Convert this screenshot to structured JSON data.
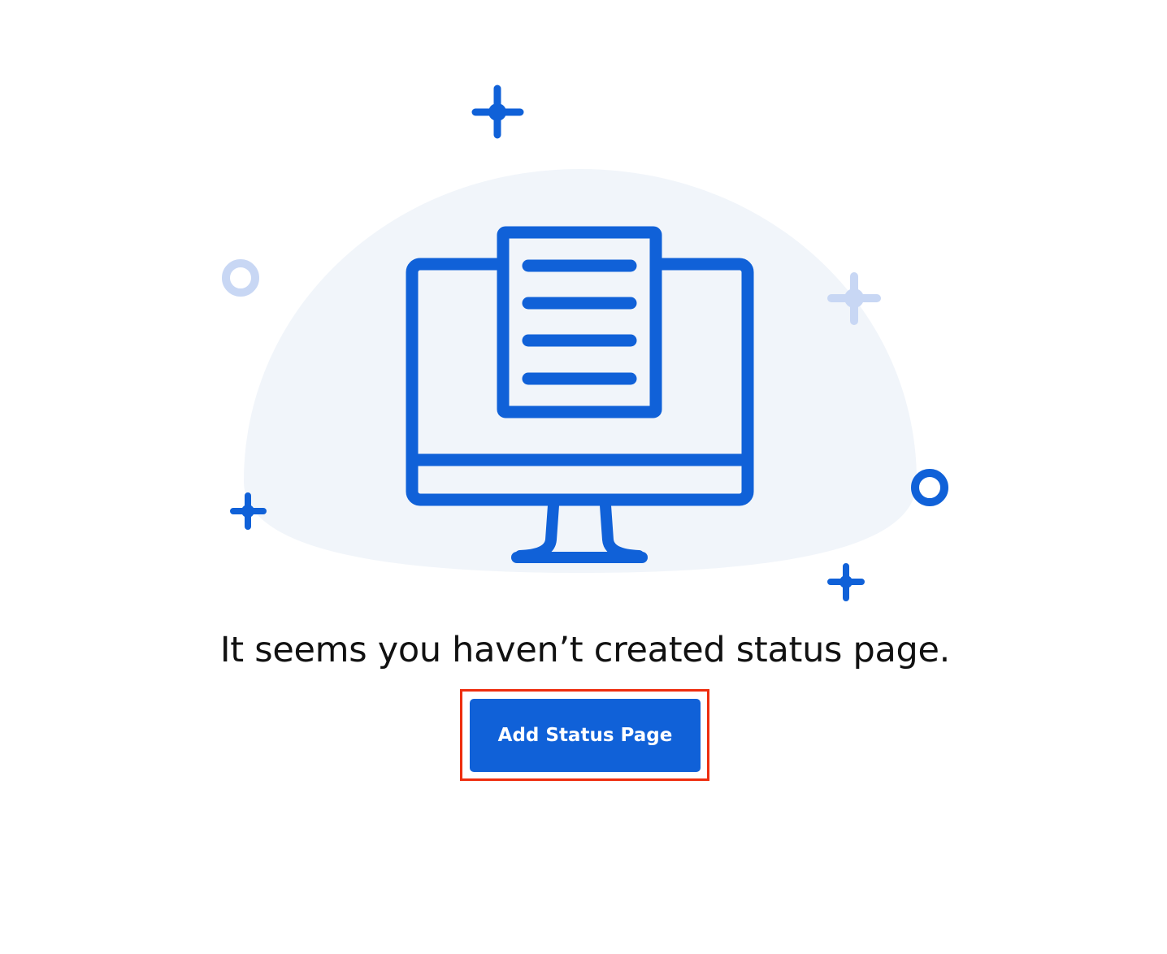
{
  "empty_state": {
    "message": "It seems you haven’t created status page.",
    "button_label": "Add Status Page"
  },
  "colors": {
    "accent": "#1061d8",
    "accent_light": "#c8d7f4",
    "backdrop": "#f1f5fa",
    "highlight": "#ee2e0f",
    "text": "#111111"
  },
  "icons": {
    "illustration": "monitor-document-icon",
    "decorations": [
      "sparkle-icon",
      "ring-icon"
    ]
  }
}
